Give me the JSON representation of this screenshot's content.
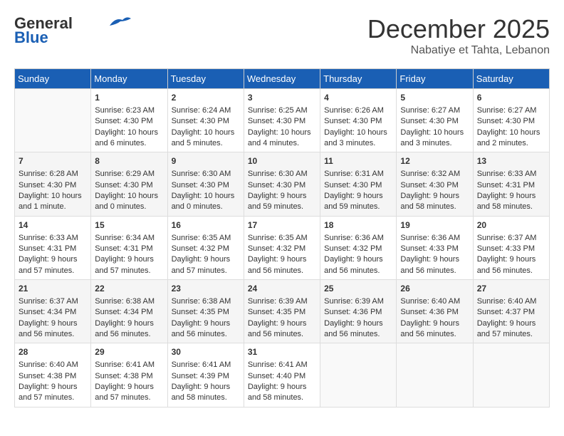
{
  "header": {
    "logo_line1": "General",
    "logo_line2": "Blue",
    "title": "December 2025",
    "subtitle": "Nabatiye et Tahta, Lebanon"
  },
  "calendar": {
    "days_of_week": [
      "Sunday",
      "Monday",
      "Tuesday",
      "Wednesday",
      "Thursday",
      "Friday",
      "Saturday"
    ],
    "weeks": [
      [
        {
          "day": "",
          "data": ""
        },
        {
          "day": "1",
          "data": "Sunrise: 6:23 AM\nSunset: 4:30 PM\nDaylight: 10 hours\nand 6 minutes."
        },
        {
          "day": "2",
          "data": "Sunrise: 6:24 AM\nSunset: 4:30 PM\nDaylight: 10 hours\nand 5 minutes."
        },
        {
          "day": "3",
          "data": "Sunrise: 6:25 AM\nSunset: 4:30 PM\nDaylight: 10 hours\nand 4 minutes."
        },
        {
          "day": "4",
          "data": "Sunrise: 6:26 AM\nSunset: 4:30 PM\nDaylight: 10 hours\nand 3 minutes."
        },
        {
          "day": "5",
          "data": "Sunrise: 6:27 AM\nSunset: 4:30 PM\nDaylight: 10 hours\nand 3 minutes."
        },
        {
          "day": "6",
          "data": "Sunrise: 6:27 AM\nSunset: 4:30 PM\nDaylight: 10 hours\nand 2 minutes."
        }
      ],
      [
        {
          "day": "7",
          "data": "Sunrise: 6:28 AM\nSunset: 4:30 PM\nDaylight: 10 hours\nand 1 minute."
        },
        {
          "day": "8",
          "data": "Sunrise: 6:29 AM\nSunset: 4:30 PM\nDaylight: 10 hours\nand 0 minutes."
        },
        {
          "day": "9",
          "data": "Sunrise: 6:30 AM\nSunset: 4:30 PM\nDaylight: 10 hours\nand 0 minutes."
        },
        {
          "day": "10",
          "data": "Sunrise: 6:30 AM\nSunset: 4:30 PM\nDaylight: 9 hours\nand 59 minutes."
        },
        {
          "day": "11",
          "data": "Sunrise: 6:31 AM\nSunset: 4:30 PM\nDaylight: 9 hours\nand 59 minutes."
        },
        {
          "day": "12",
          "data": "Sunrise: 6:32 AM\nSunset: 4:30 PM\nDaylight: 9 hours\nand 58 minutes."
        },
        {
          "day": "13",
          "data": "Sunrise: 6:33 AM\nSunset: 4:31 PM\nDaylight: 9 hours\nand 58 minutes."
        }
      ],
      [
        {
          "day": "14",
          "data": "Sunrise: 6:33 AM\nSunset: 4:31 PM\nDaylight: 9 hours\nand 57 minutes."
        },
        {
          "day": "15",
          "data": "Sunrise: 6:34 AM\nSunset: 4:31 PM\nDaylight: 9 hours\nand 57 minutes."
        },
        {
          "day": "16",
          "data": "Sunrise: 6:35 AM\nSunset: 4:32 PM\nDaylight: 9 hours\nand 57 minutes."
        },
        {
          "day": "17",
          "data": "Sunrise: 6:35 AM\nSunset: 4:32 PM\nDaylight: 9 hours\nand 56 minutes."
        },
        {
          "day": "18",
          "data": "Sunrise: 6:36 AM\nSunset: 4:32 PM\nDaylight: 9 hours\nand 56 minutes."
        },
        {
          "day": "19",
          "data": "Sunrise: 6:36 AM\nSunset: 4:33 PM\nDaylight: 9 hours\nand 56 minutes."
        },
        {
          "day": "20",
          "data": "Sunrise: 6:37 AM\nSunset: 4:33 PM\nDaylight: 9 hours\nand 56 minutes."
        }
      ],
      [
        {
          "day": "21",
          "data": "Sunrise: 6:37 AM\nSunset: 4:34 PM\nDaylight: 9 hours\nand 56 minutes."
        },
        {
          "day": "22",
          "data": "Sunrise: 6:38 AM\nSunset: 4:34 PM\nDaylight: 9 hours\nand 56 minutes."
        },
        {
          "day": "23",
          "data": "Sunrise: 6:38 AM\nSunset: 4:35 PM\nDaylight: 9 hours\nand 56 minutes."
        },
        {
          "day": "24",
          "data": "Sunrise: 6:39 AM\nSunset: 4:35 PM\nDaylight: 9 hours\nand 56 minutes."
        },
        {
          "day": "25",
          "data": "Sunrise: 6:39 AM\nSunset: 4:36 PM\nDaylight: 9 hours\nand 56 minutes."
        },
        {
          "day": "26",
          "data": "Sunrise: 6:40 AM\nSunset: 4:36 PM\nDaylight: 9 hours\nand 56 minutes."
        },
        {
          "day": "27",
          "data": "Sunrise: 6:40 AM\nSunset: 4:37 PM\nDaylight: 9 hours\nand 57 minutes."
        }
      ],
      [
        {
          "day": "28",
          "data": "Sunrise: 6:40 AM\nSunset: 4:38 PM\nDaylight: 9 hours\nand 57 minutes."
        },
        {
          "day": "29",
          "data": "Sunrise: 6:41 AM\nSunset: 4:38 PM\nDaylight: 9 hours\nand 57 minutes."
        },
        {
          "day": "30",
          "data": "Sunrise: 6:41 AM\nSunset: 4:39 PM\nDaylight: 9 hours\nand 58 minutes."
        },
        {
          "day": "31",
          "data": "Sunrise: 6:41 AM\nSunset: 4:40 PM\nDaylight: 9 hours\nand 58 minutes."
        },
        {
          "day": "",
          "data": ""
        },
        {
          "day": "",
          "data": ""
        },
        {
          "day": "",
          "data": ""
        }
      ]
    ]
  }
}
